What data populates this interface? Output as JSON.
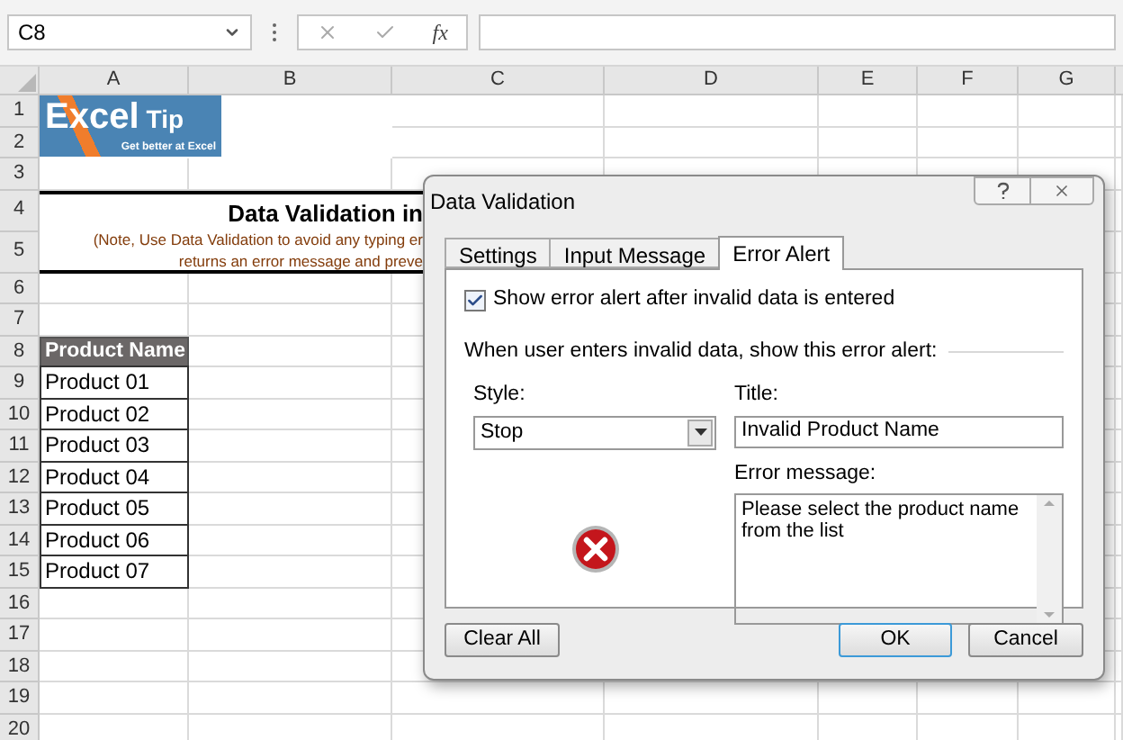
{
  "formula_bar": {
    "name_box": "C8",
    "function_label": "fx"
  },
  "columns": [
    "A",
    "B",
    "C",
    "D",
    "E",
    "F",
    "G"
  ],
  "rows": [
    "1",
    "2",
    "3",
    "4",
    "5",
    "6",
    "7",
    "8",
    "9",
    "10",
    "11",
    "12",
    "13",
    "14",
    "15",
    "16",
    "17",
    "18",
    "19",
    "20"
  ],
  "logo": {
    "word": "Excel",
    "word2": "Tip",
    "tagline": "Get better at Excel"
  },
  "heading": {
    "title": "Data Validation in",
    "note_lines": [
      "(Note, Use Data Validation to avoid any typing er",
      "returns an error message and preve"
    ]
  },
  "product_table": {
    "header": "Product Name",
    "items": [
      "Product 01",
      "Product 02",
      "Product 03",
      "Product 04",
      "Product 05",
      "Product 06",
      "Product 07"
    ]
  },
  "dialog": {
    "title": "Data Validation",
    "tabs": [
      {
        "label": "Settings",
        "selected": false
      },
      {
        "label": "Input Message",
        "selected": false
      },
      {
        "label": "Error Alert",
        "selected": true
      }
    ],
    "show_alert": {
      "label": "Show error alert after invalid data is entered",
      "checked": true
    },
    "group_label": "When user enters invalid data, show this error alert:",
    "style": {
      "label": "Style:",
      "value": "Stop"
    },
    "alert_title": {
      "label": "Title:",
      "value": "Invalid Product Name"
    },
    "error_message": {
      "label": "Error message:",
      "value": "Please select the product name from the list"
    },
    "buttons": [
      {
        "label": "Clear All",
        "kind": "plain"
      },
      {
        "label": "OK",
        "kind": "default"
      },
      {
        "label": "Cancel",
        "kind": "plain"
      }
    ]
  }
}
